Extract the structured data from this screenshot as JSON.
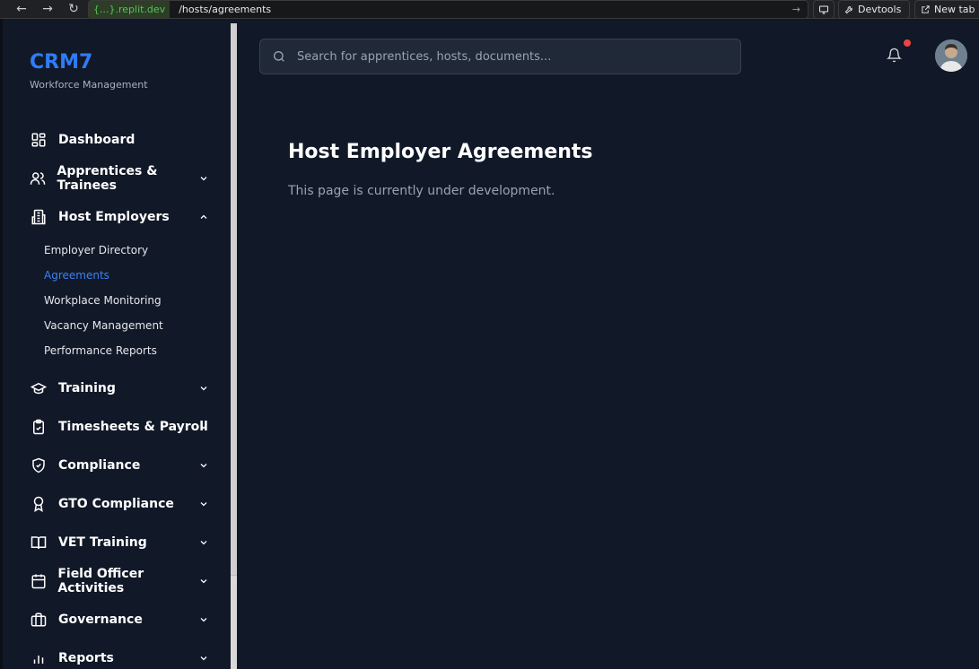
{
  "browser": {
    "domain": "{...}.replit.dev",
    "path": "/hosts/agreements",
    "devtools_label": "Devtools",
    "new_tab_label": "New tab"
  },
  "sidebar": {
    "brand": "CRM7",
    "brand_sub": "Workforce Management",
    "items": [
      {
        "label": "Dashboard",
        "icon": "dashboard-icon"
      },
      {
        "label": "Apprentices & Trainees",
        "icon": "users-icon"
      },
      {
        "label": "Host Employers",
        "icon": "building-icon",
        "expanded": true
      },
      {
        "label": "Training",
        "icon": "graduation-cap-icon"
      },
      {
        "label": "Timesheets & Payroll",
        "icon": "clipboard-check-icon"
      },
      {
        "label": "Compliance",
        "icon": "shield-check-icon"
      },
      {
        "label": "GTO Compliance",
        "icon": "award-icon"
      },
      {
        "label": "VET Training",
        "icon": "book-open-icon"
      },
      {
        "label": "Field Officer Activities",
        "icon": "calendar-icon"
      },
      {
        "label": "Governance",
        "icon": "briefcase-icon"
      },
      {
        "label": "Reports",
        "icon": "bar-chart-icon"
      }
    ],
    "host_subitems": [
      {
        "label": "Employer Directory",
        "active": false
      },
      {
        "label": "Agreements",
        "active": true
      },
      {
        "label": "Workplace Monitoring",
        "active": false
      },
      {
        "label": "Vacancy Management",
        "active": false
      },
      {
        "label": "Performance Reports",
        "active": false
      }
    ]
  },
  "header": {
    "search_placeholder": "Search for apprentices, hosts, documents..."
  },
  "main": {
    "title": "Host Employer Agreements",
    "description": "This page is currently under development."
  },
  "colors": {
    "background": "#111827",
    "accent": "#3b82f6",
    "brand": "#2f7cf6",
    "notification": "#ef4444"
  }
}
